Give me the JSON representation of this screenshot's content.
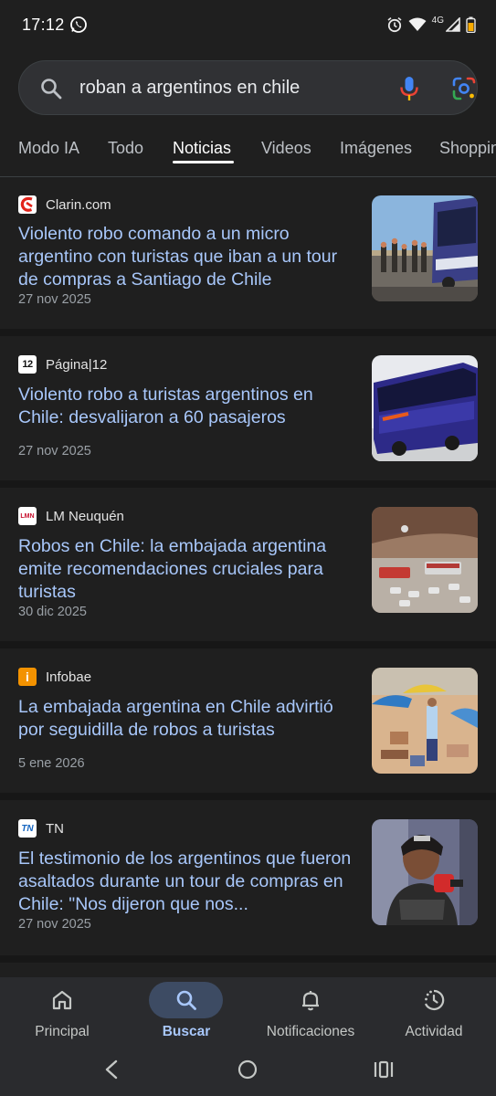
{
  "status": {
    "time": "17:12",
    "network": "4G"
  },
  "search": {
    "query": "roban a argentinos en chile"
  },
  "tabs": [
    {
      "label": "Modo IA"
    },
    {
      "label": "Todo"
    },
    {
      "label": "Noticias"
    },
    {
      "label": "Videos"
    },
    {
      "label": "Imágenes"
    },
    {
      "label": "Shopping"
    }
  ],
  "results": [
    {
      "source": "Clarin.com",
      "favicon": "clarin-icon",
      "headline": "Violento robo comando a un micro argentino con turistas que iban a un tour de compras a Santiago de Chile",
      "date": "27 nov 2025",
      "thumb": "road-bus-crowd-image"
    },
    {
      "source": "Página|12",
      "favicon": "pagina12-icon",
      "headline": "Violento robo a turistas argentinos en Chile: desvalijaron a 60 pasajeros",
      "date": "27 nov 2025",
      "thumb": "blue-bus-image"
    },
    {
      "source": "LM Neuquén",
      "favicon": "lmneuquen-icon",
      "headline": "Robos en Chile: la embajada argentina emite recomendaciones cruciales para turistas",
      "date": "30 dic 2025",
      "thumb": "border-crossing-image"
    },
    {
      "source": "Infobae",
      "favicon": "infobae-icon",
      "headline": "La embajada argentina en Chile advirtió por seguidilla de robos a turistas",
      "date": "5 ene 2026",
      "thumb": "beach-crowd-image"
    },
    {
      "source": "TN",
      "favicon": "tn-icon",
      "headline": "El testimonio de los argentinos que fueron asaltados durante un tour de compras en Chile: \"Nos dijeron que nos...",
      "date": "27 nov 2025",
      "thumb": "woman-interview-image"
    }
  ],
  "bottom_nav": [
    {
      "label": "Principal",
      "icon": "home-icon"
    },
    {
      "label": "Buscar",
      "icon": "search-icon"
    },
    {
      "label": "Notificaciones",
      "icon": "bell-icon"
    },
    {
      "label": "Actividad",
      "icon": "activity-icon"
    }
  ],
  "colors": {
    "background": "#1f1f1f",
    "link": "#a8c7fa",
    "separator": "#171717",
    "active_pill": "#3d4b63"
  }
}
